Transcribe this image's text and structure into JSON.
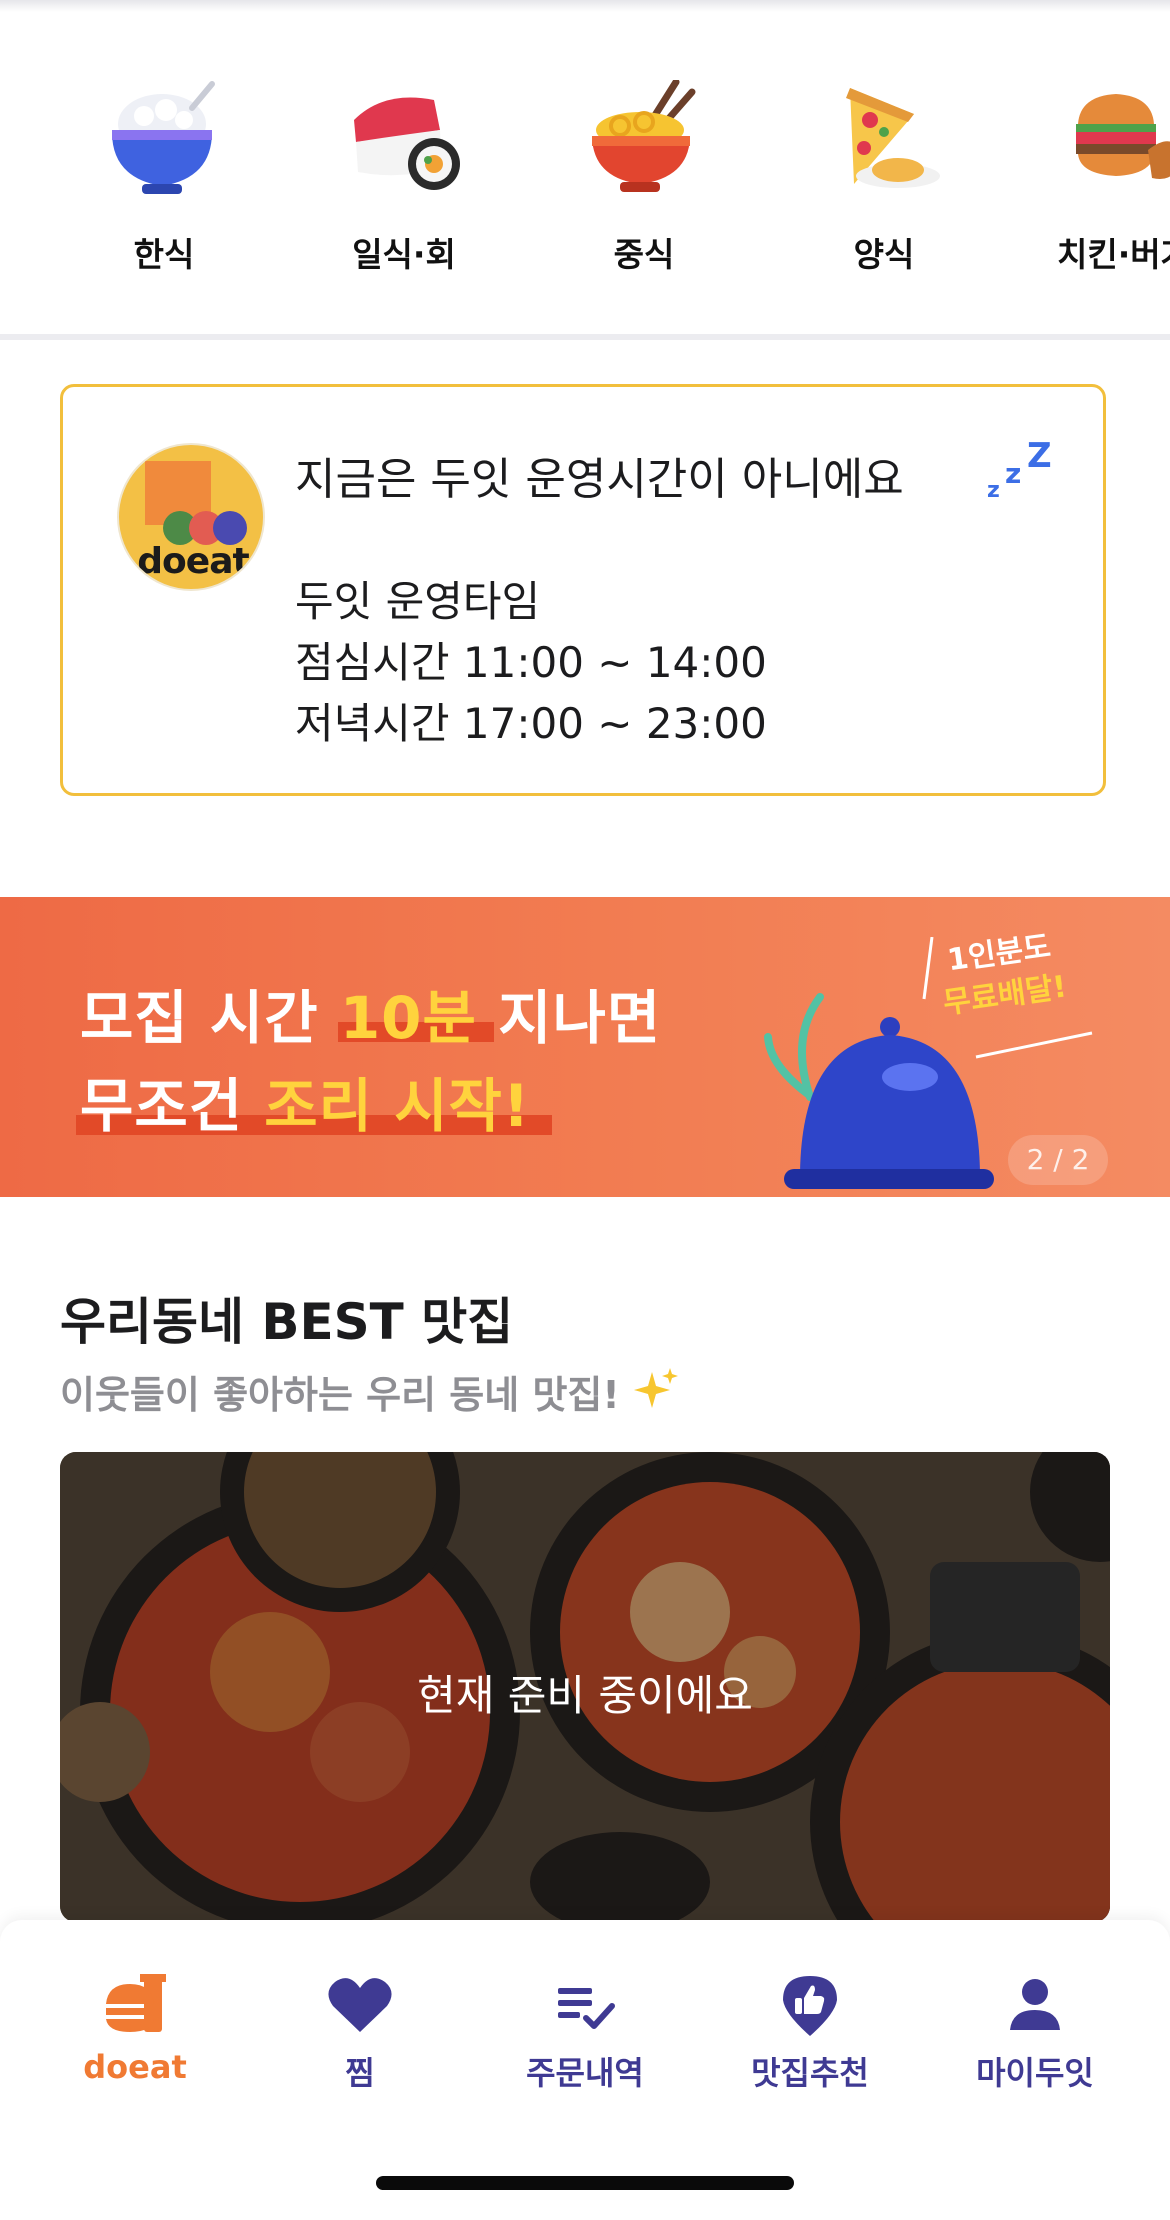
{
  "categories": [
    {
      "label": "한식",
      "icon": "rice-bowl-icon"
    },
    {
      "label": "일식·회",
      "icon": "sushi-icon"
    },
    {
      "label": "중식",
      "icon": "noodle-bowl-icon"
    },
    {
      "label": "양식",
      "icon": "pizza-icon"
    },
    {
      "label": "치킨·버거",
      "icon": "burger-chicken-icon"
    }
  ],
  "notice": {
    "logo_text": "doeat",
    "title": "지금은 두잇 운영시간이 아니에요",
    "zzz": "zzZ",
    "hours_heading": "두잇 운영타임",
    "lunch": "점심시간 11:00 ~ 14:00",
    "dinner": "저녁시간 17:00 ~ 23:00"
  },
  "banner": {
    "line1_pre": "모집 시간 ",
    "line1_hl": "10분",
    "line1_post": " 지나면",
    "line2_pre": "무조건 ",
    "line2_hl": "조리 시작!",
    "side_1": "1인분도",
    "side_2": "무료배달!",
    "pager": "2 / 2"
  },
  "best": {
    "title": "우리동네 BEST 맛집",
    "subtitle": "이웃들이 좋아하는 우리 동네 맛집!",
    "card_status": "현재 준비 중이에요"
  },
  "tabs": [
    {
      "label": "doeat",
      "icon": "doeat-home-icon"
    },
    {
      "label": "찜",
      "icon": "heart-icon"
    },
    {
      "label": "주문내역",
      "icon": "order-list-icon"
    },
    {
      "label": "맛집추천",
      "icon": "thumbs-up-pin-icon"
    },
    {
      "label": "마이두잇",
      "icon": "person-icon"
    }
  ],
  "colors": {
    "accent_orange": "#f07a33",
    "tab_purple": "#3f3a93",
    "notice_border": "#f2bf3c",
    "banner_orange": "#f27d52",
    "highlight_yellow": "#ffd33d"
  }
}
